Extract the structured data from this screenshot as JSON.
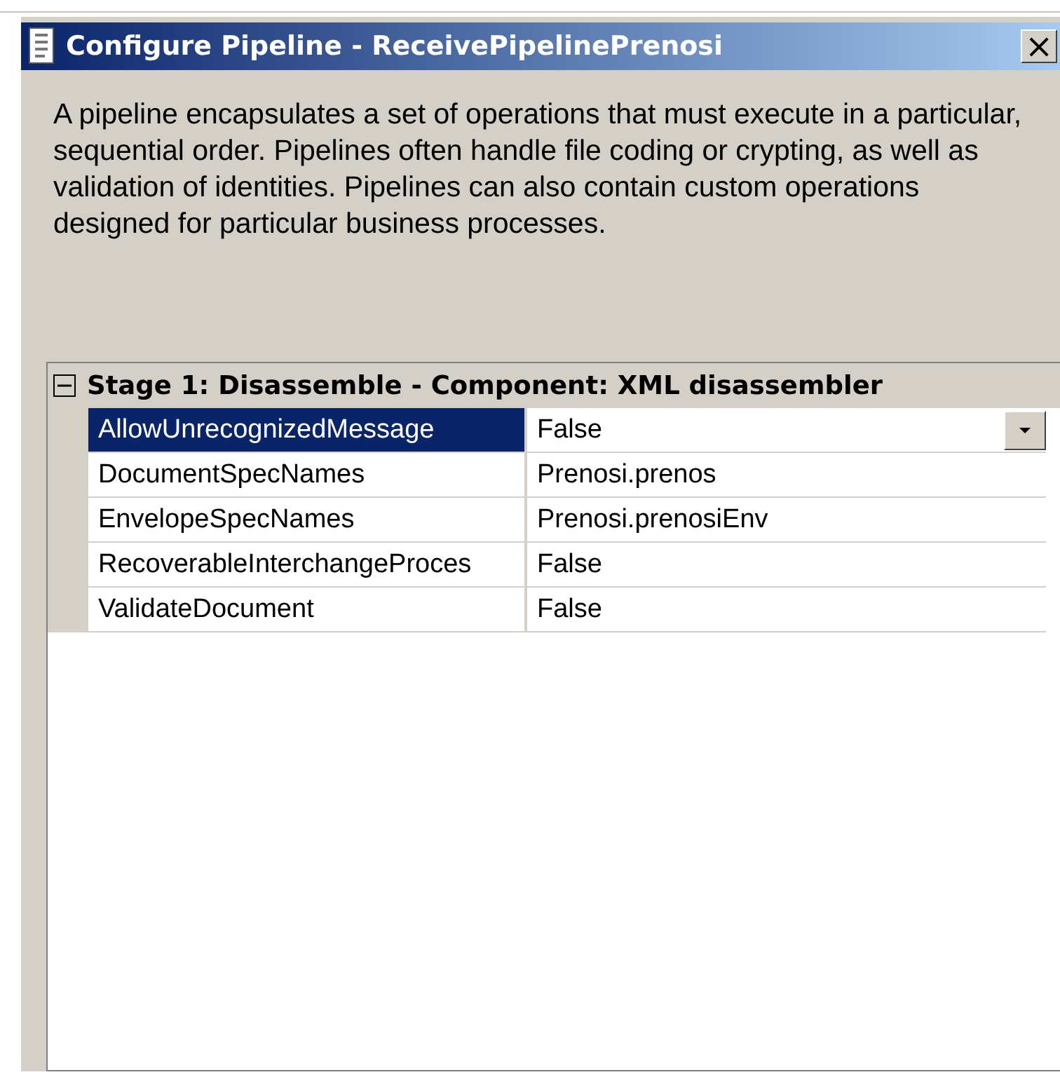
{
  "window": {
    "title": "Configure Pipeline - ReceivePipelinePrenosi",
    "close": "×"
  },
  "description": "A pipeline encapsulates a set of operations that must execute in a particular, sequential order. Pipelines often handle file coding or crypting, as well as validation of identities. Pipelines can also contain custom operations designed for particular business processes.",
  "property_grid": {
    "category": {
      "label": "Stage 1: Disassemble - Component: XML disassembler",
      "expanded": true
    },
    "rows": [
      {
        "name": "AllowUnrecognizedMessage",
        "value": "False",
        "selected": true
      },
      {
        "name": "DocumentSpecNames",
        "value": "Prenosi.prenos",
        "selected": false
      },
      {
        "name": "EnvelopeSpecNames",
        "value": "Prenosi.prenosiEnv",
        "selected": false
      },
      {
        "name": "RecoverableInterchangeProces",
        "value": "False",
        "selected": false
      },
      {
        "name": "ValidateDocument",
        "value": "False",
        "selected": false
      }
    ]
  }
}
